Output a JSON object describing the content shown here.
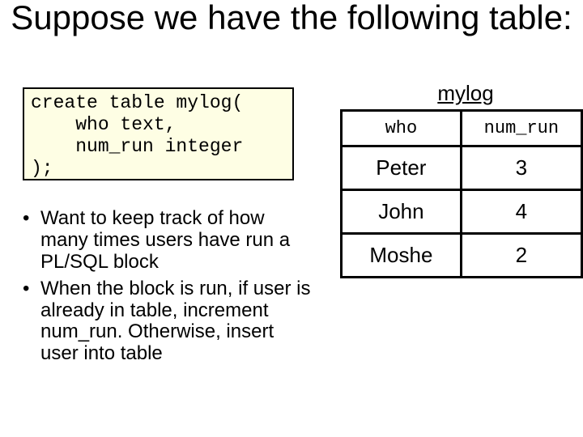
{
  "title": "Suppose we have the following table:",
  "code": "create table mylog(\n    who text,\n    num_run integer\n);",
  "bullets": [
    "Want to keep track of how many times users have run a PL/SQL block",
    "When the block is run, if user is already in table, increment num_run. Otherwise, insert user into table"
  ],
  "table_caption": "mylog",
  "chart_data": {
    "type": "table",
    "title": "mylog",
    "columns": [
      "who",
      "num_run"
    ],
    "rows": [
      {
        "who": "Peter",
        "num_run": 3
      },
      {
        "who": "John",
        "num_run": 4
      },
      {
        "who": "Moshe",
        "num_run": 2
      }
    ]
  }
}
